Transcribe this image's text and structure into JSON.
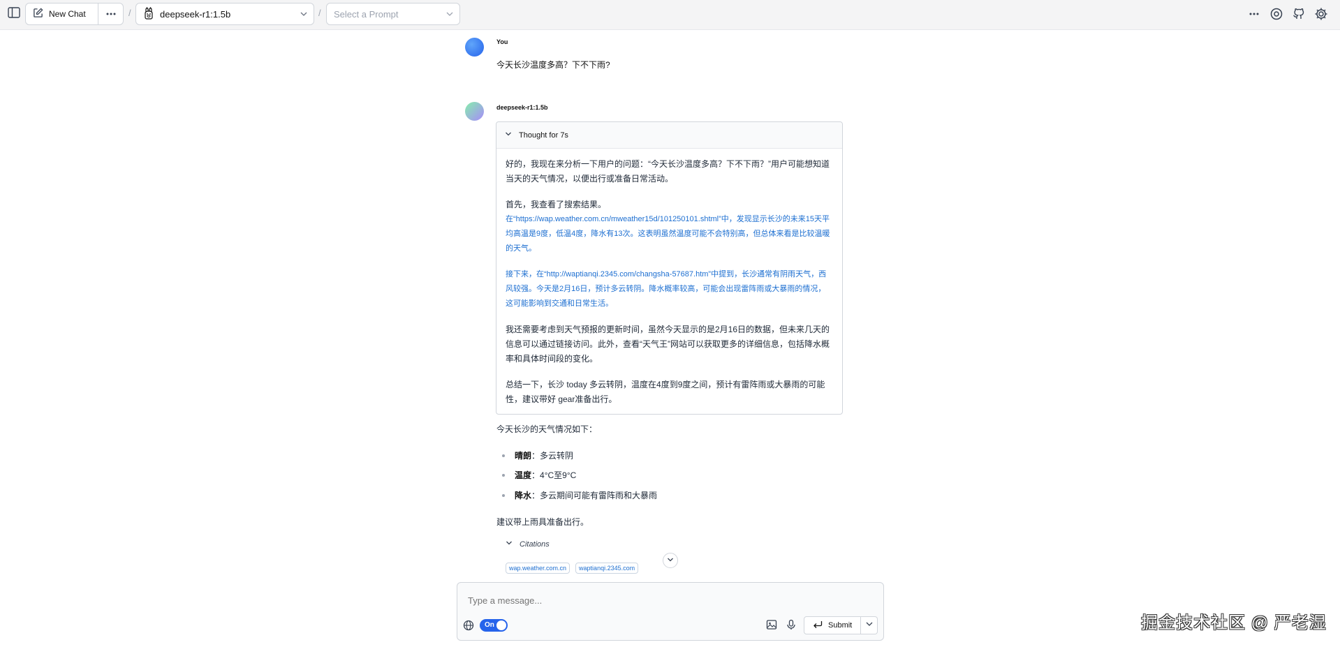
{
  "topbar": {
    "new_chat_label": "New Chat",
    "model_name": "deepseek-r1:1.5b",
    "prompt_placeholder": "Select a Prompt",
    "separator": "/"
  },
  "conversation": {
    "user": {
      "sender": "You",
      "message": "今天长沙温度多高？下不下雨?"
    },
    "assistant": {
      "sender": "deepseek-r1:1.5b",
      "thought": {
        "title": "Thought for 7s",
        "paragraphs": [
          "好的，我现在来分析一下用户的问题：“今天长沙温度多高？下不下雨？”用户可能想知道当天的天气情况，以便出行或准备日常活动。",
          "首先，我查看了搜索结果。",
          "在“https://wap.weather.com.cn/mweather15d/101250101.shtml”中，发现显示长沙的未来15天平均高温是9度，低温4度，降水有13次。这表明虽然温度可能不会特别高，但总体来看是比较温暖的天气。",
          "接下来，在“http://waptianqi.2345.com/changsha-57687.htm”中提到，长沙通常有阴雨天气，西风较强。今天是2月16日，预计多云转阴。降水概率较高，可能会出现雷阵雨或大暴雨的情况，这可能影响到交通和日常生活。",
          "我还需要考虑到天气预报的更新时间，虽然今天显示的是2月16日的数据，但未来几天的信息可以通过链接访问。此外，查看“天气王”网站可以获取更多的详细信息，包括降水概率和具体时间段的变化。",
          "总结一下，长沙 today 多云转阴，温度在4度到9度之间，预计有雷阵雨或大暴雨的可能性，建议带好 gear准备出行。"
        ]
      },
      "answer": {
        "intro": "今天长沙的天气情况如下：",
        "items": [
          {
            "label": "晴朗",
            "value": "：多云转阴"
          },
          {
            "label": "温度",
            "value": "：4°C至9°C"
          },
          {
            "label": "降水",
            "value": "：多云期间可能有雷阵雨和大暴雨"
          }
        ],
        "advice": "建议带上雨具准备出行。"
      },
      "citations": {
        "title": "Citations",
        "sources": [
          "wap.weather.com.cn",
          "waptianqi.2345.com"
        ]
      }
    }
  },
  "composer": {
    "placeholder": "Type a message...",
    "web_search_toggle": "On",
    "submit_label": "Submit"
  },
  "watermark": "掘金技术社区 @ 严老湿"
}
